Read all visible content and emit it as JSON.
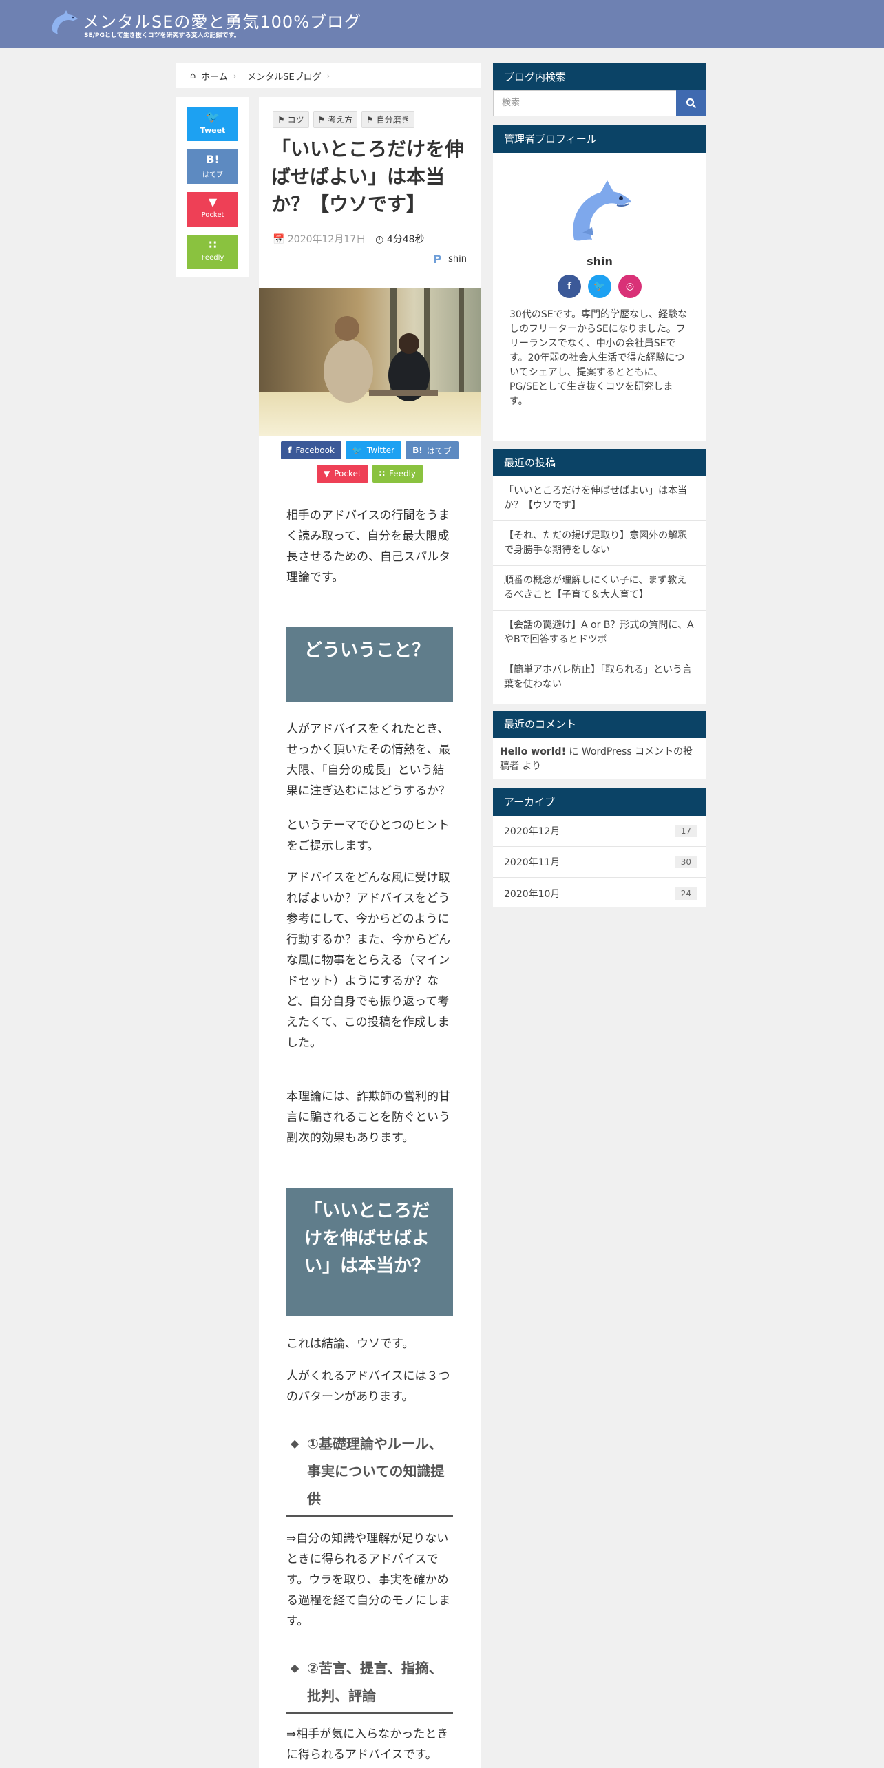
{
  "header": {
    "title": "メンタルSEの愛と勇気100%ブログ",
    "tagline": "SE/PGとして生き抜くコツを研究する変人の記録です。"
  },
  "breadcrumb": {
    "home": "ホーム",
    "category": "メンタルSEブログ"
  },
  "share_side": {
    "tweet": "Tweet",
    "hatena_icon": "B!",
    "hatena": "はてブ",
    "pocket": "Pocket",
    "feedly": "Feedly"
  },
  "article": {
    "tags": [
      "コツ",
      "考え方",
      "自分磨き"
    ],
    "title": "「いいところだけを伸ばせばよい」は本当か？【ウソです】",
    "date": "2020年12月17日",
    "read_time": "4分48秒",
    "author": "shin",
    "share": {
      "facebook": "Facebook",
      "twitter": "Twitter",
      "hatena_icon": "B!",
      "hatena": "はてブ",
      "pocket": "Pocket",
      "feedly": "Feedly"
    },
    "intro": "相手のアドバイスの行間をうまく読み取って、自分を最大限成長させるための、自己スパルタ理論です。",
    "h2_1": "どういうこと？",
    "p1": "人がアドバイスをくれたとき、せっかく頂いたその情熱を、最大限、「自分の成長」という結果に注ぎ込むにはどうするか？",
    "p2": "というテーマでひとつのヒントをご提示します。",
    "p3": "アドバイスをどんな風に受け取ればよいか？アドバイスをどう参考にして、今からどのように行動するか？また、今からどんな風に物事をとらえる（マインドセット）ようにするか？など、自分自身でも振り返って考えたくて、この投稿を作成しました。",
    "p4": "本理論には、詐欺師の営利的甘言に騙されることを防ぐという副次的効果もあります。",
    "h2_2": "「いいところだけを伸ばせばよい」は本当か？",
    "p5": "これは結論、ウソです。",
    "p6": "人がくれるアドバイスには３つのパターンがあります。",
    "h3_1": "①基礎理論やルール、事実についての知識提供",
    "p7": "⇒自分の知識や理解が足りないときに得られるアドバイスです。ウラを取り、事実を確かめる過程を経て自分のモノにします。",
    "h3_2": "②苦言、提言、指摘、批判、評論",
    "p8": "⇒相手が気に入らなかったときに得られるアドバイスです。"
  },
  "sidebar": {
    "search": {
      "heading": "ブログ内検索",
      "placeholder": "検索"
    },
    "profile": {
      "heading": "管理者プロフィール",
      "name": "shin",
      "text": "30代のSEです。専門的学歴なし、経験なしのフリーターからSEになりました。フリーランスでなく、中小の会社員SEです。20年弱の社会人生活で得た経験についてシェアし、提案するとともに、PG/SEとして生き抜くコツを研究します。"
    },
    "recent_posts": {
      "heading": "最近の投稿",
      "items": [
        "「いいところだけを伸ばせばよい」は本当か？【ウソです】",
        "【それ、ただの揚げ足取り】意図外の解釈で身勝手な期待をしない",
        "順番の概念が理解しにくい子に、まず教えるべきこと【子育て＆大人育て】",
        "【会話の罠避け】A or B？形式の質問に、AやBで回答するとドツボ",
        "【簡単アホバレ防止】「取られる」という言葉を使わない"
      ]
    },
    "recent_comments": {
      "heading": "最近のコメント",
      "link": "Hello world!",
      "text": " に WordPress コメントの投稿者 より"
    },
    "archives": {
      "heading": "アーカイブ",
      "items": [
        {
          "label": "2020年12月",
          "count": "17"
        },
        {
          "label": "2020年11月",
          "count": "30"
        },
        {
          "label": "2020年10月",
          "count": "24"
        }
      ]
    }
  },
  "colors": {
    "header": "#6e81b2",
    "sidebar_heading": "#0b4366",
    "h2_box": "#607d8b",
    "twitter": "#1da1f2",
    "hatena": "#5d8ac1",
    "pocket": "#ee4056",
    "feedly": "#8ac23f",
    "facebook": "#3b5998"
  }
}
